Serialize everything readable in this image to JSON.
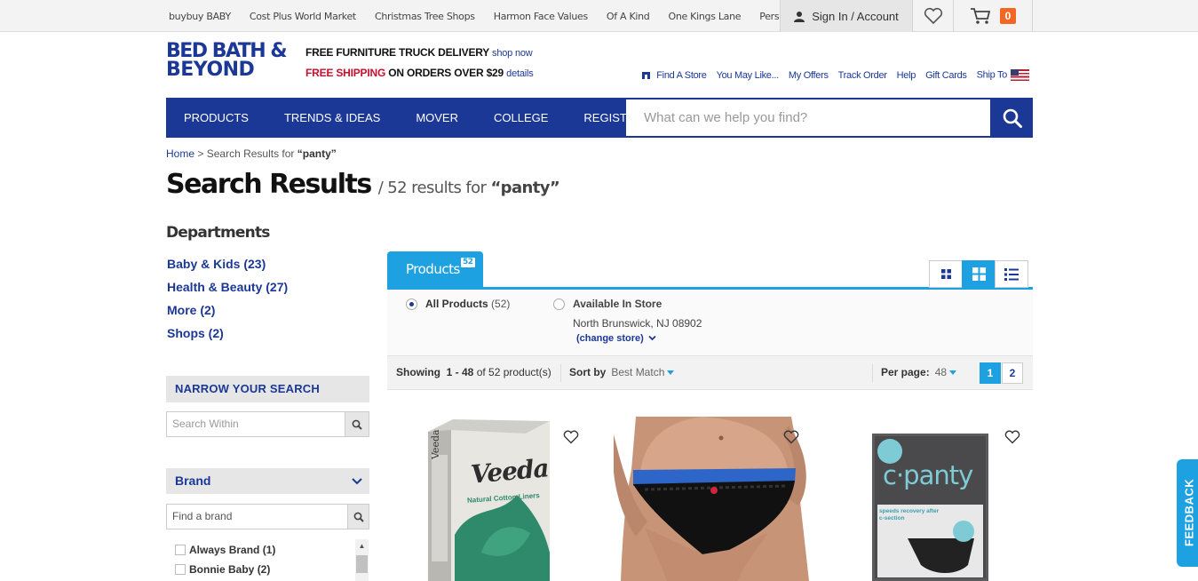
{
  "topbar": {
    "sister_sites": [
      "buybuy BABY",
      "Cost Plus World Market",
      "Christmas Tree Shops",
      "Harmon Face Values",
      "Of A Kind",
      "One Kings Lane",
      "Personalization Mall"
    ],
    "account_label": "Sign In / Account",
    "cart_count": "0"
  },
  "header": {
    "logo_line1": "BED BATH &",
    "logo_line2": "BEYOND",
    "promo1": "FREE FURNITURE TRUCK DELIVERY",
    "promo1_link": "shop now",
    "promo2_red": "FREE SHIPPING",
    "promo2_rest": "ON ORDERS OVER $29",
    "promo2_link": "details",
    "utility_links": [
      "Find A Store",
      "You May Like...",
      "My Offers",
      "Track Order",
      "Help",
      "Gift Cards",
      "Ship To"
    ]
  },
  "nav": {
    "items": [
      "PRODUCTS",
      "TRENDS & IDEAS",
      "MOVER",
      "COLLEGE",
      "REGISTRY"
    ],
    "search_placeholder": "What can we help you find?"
  },
  "breadcrumb": {
    "home": "Home",
    "sep": ">",
    "text": "Search Results for",
    "term": "“panty”"
  },
  "title": {
    "main": "Search Results",
    "sub": "/ 52 results for",
    "term": "“panty”"
  },
  "sidebar": {
    "departments_heading": "Departments",
    "departments": [
      "Baby & Kids (23)",
      "Health & Beauty (27)",
      "More (2)",
      "Shops (2)"
    ],
    "narrow_heading": "NARROW YOUR SEARCH",
    "search_within_placeholder": "Search Within",
    "brand_heading": "Brand",
    "find_brand_placeholder": "Find a brand",
    "brands": [
      {
        "name": "Always Brand",
        "count": "(1)"
      },
      {
        "name": "Bonnie Baby",
        "count": "(2)"
      }
    ]
  },
  "results": {
    "tab_label": "Products",
    "tab_count": "52",
    "all_products_label": "All Products",
    "all_products_count": "(52)",
    "available_label": "Available In Store",
    "store_location": "North Brunswick, NJ 08902",
    "change_store": "(change store)",
    "showing_label": "Showing",
    "showing_range": "1 - 48",
    "showing_total": "of 52 product(s)",
    "sort_label": "Sort by",
    "sort_value": "Best Match",
    "per_page_label": "Per page:",
    "per_page_value": "48",
    "pages": [
      "1",
      "2"
    ]
  },
  "products": [
    {
      "brand_text": "Veeda",
      "sub_text": "Natural Cotton Liners"
    },
    {
      "brand_text": "",
      "sub_text": ""
    },
    {
      "brand_text": "c·panty",
      "sub_text": "speeds recovery after c-section"
    }
  ],
  "feedback_label": "FEEDBACK",
  "colors": {
    "brand_blue": "#1b3896",
    "accent_blue": "#1da1e0",
    "cart_orange": "#f26722",
    "promo_red": "#c8102e"
  }
}
